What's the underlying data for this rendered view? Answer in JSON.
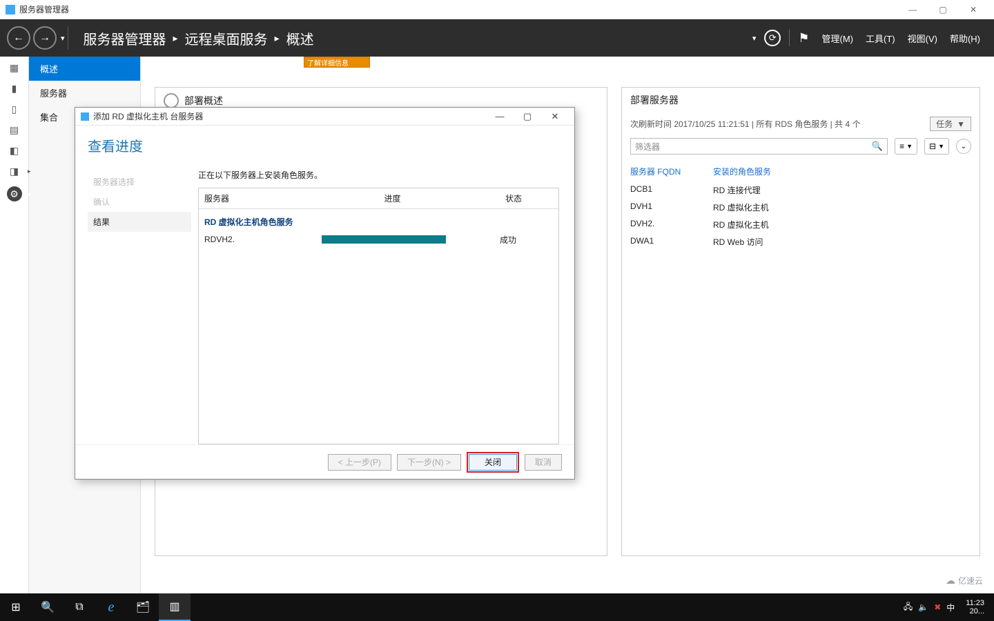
{
  "window": {
    "title": "服务器管理器",
    "minimize": "—",
    "maximize": "▢",
    "close": "✕"
  },
  "header": {
    "crumb1": "服务器管理器",
    "crumb2": "远程桌面服务",
    "crumb3": "概述",
    "sep": "▸",
    "tail_dd": "▾",
    "refresh": "⟳",
    "flag": "⚑",
    "menu_manage": "管理(M)",
    "menu_tools": "工具(T)",
    "menu_view": "视图(V)",
    "menu_help": "帮助(H)"
  },
  "rail": {
    "ic1": "▦",
    "ic2": "▮",
    "ic3": "▯",
    "ic4": "▤",
    "ic5": "◧",
    "ic6": "◨",
    "ic7": "⚙"
  },
  "sidebar": {
    "items": [
      "概述",
      "服务器",
      "集合"
    ]
  },
  "content": {
    "banner_frag": "了解详细信息",
    "left_title": "部署概述",
    "right_title": "部署服务器",
    "right_sub": "次刷新时间 2017/10/25 11:21:51 | 所有 RDS 角色服务 | 共 4 个",
    "tasks": "任务",
    "dd": "▼",
    "filter_ph": "筛选器",
    "pill1": "≡",
    "pill2": "⊟",
    "expand": "⌄",
    "col_fqdn": "服务器 FQDN",
    "col_role": "安装的角色服务",
    "rows": [
      {
        "fqdn": "DCB1",
        "role": "RD 连接代理"
      },
      {
        "fqdn": "DVH1",
        "role": "RD 虚拟化主机"
      },
      {
        "fqdn": "DVH2.",
        "role": "RD 虚拟化主机"
      },
      {
        "fqdn": "DWA1",
        "role": "RD Web 访问"
      }
    ]
  },
  "wizard": {
    "title": "添加 RD 虚拟化主机 台服务器",
    "subtitle": "查看进度",
    "steps": [
      "服务器选择",
      "确认",
      "结果"
    ],
    "active_step": 2,
    "msg": "正在以下服务器上安装角色服务。",
    "col_server": "服务器",
    "col_progress": "进度",
    "col_status": "状态",
    "role_line": "RD 虚拟化主机角色服务",
    "server": "RDVH2.",
    "status": "成功",
    "btn_prev": "< 上一步(P)",
    "btn_next": "下一步(N) >",
    "btn_close": "关闭",
    "btn_cancel": "取消",
    "win_min": "—",
    "win_max": "▢",
    "win_close": "✕"
  },
  "taskbar": {
    "start": "⊞",
    "search": "🔍",
    "taskview": "⧉",
    "ie": "e",
    "explorer": "🗂",
    "srvmgr": "▥",
    "tray_net": "🖧",
    "tray_vol": "🔈",
    "tray_warn": "✖",
    "ime": "中",
    "time": "11:23",
    "date": "20..."
  },
  "watermark": "亿速云"
}
